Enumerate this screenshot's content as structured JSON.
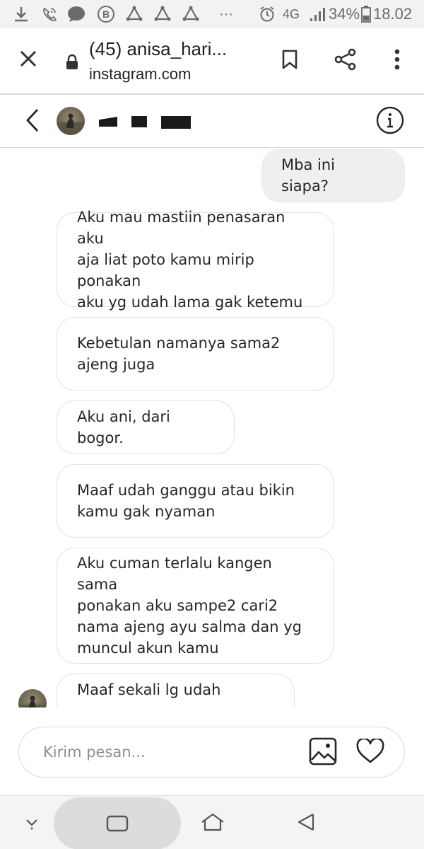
{
  "status_bar": {
    "network": "4G",
    "battery": "34%",
    "time": "18.02",
    "more": "···"
  },
  "browser": {
    "title": "(45) anisa_hari...",
    "url": "instagram.com"
  },
  "chat": {
    "messages": [
      {
        "direction": "outgoing",
        "text": "Mba ini siapa?"
      },
      {
        "direction": "incoming",
        "text": "Aku mau mastiin penasaran aku\naja liat poto kamu mirip ponakan\naku yg udah lama gak ketemu"
      },
      {
        "direction": "incoming",
        "text": "Kebetulan namanya sama2\najeng juga"
      },
      {
        "direction": "incoming",
        "text": "Aku ani, dari bogor."
      },
      {
        "direction": "incoming",
        "text": "Maaf udah ganggu atau bikin\nkamu gak nyaman"
      },
      {
        "direction": "incoming",
        "text": "Aku cuman terlalu kangen sama\nponakan aku sampe2 cari2\nnama ajeng ayu salma dan yg\nmuncul akun kamu"
      },
      {
        "direction": "incoming",
        "text": "Maaf sekali lg udah ganggu"
      }
    ]
  },
  "composer": {
    "placeholder": "Kirim pesan..."
  }
}
